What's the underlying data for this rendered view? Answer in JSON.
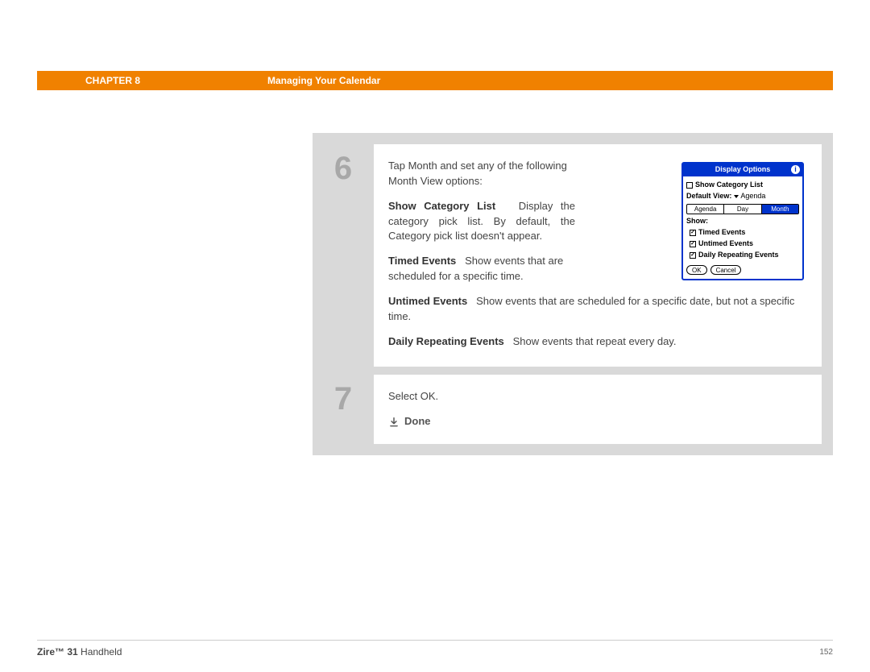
{
  "header": {
    "chapter": "CHAPTER 8",
    "title": "Managing Your Calendar"
  },
  "steps": [
    {
      "num": "6",
      "intro": "Tap Month and set any of the following Month View options:",
      "items": [
        {
          "label": "Show Category List",
          "desc": "Display the category pick list. By default, the Category pick list doesn't appear."
        },
        {
          "label": "Timed Events",
          "desc": "Show events that are scheduled for a specific time."
        },
        {
          "label": "Untimed Events",
          "desc": "Show events that are scheduled for a specific date, but not a specific time."
        },
        {
          "label": "Daily Repeating Events",
          "desc": "Show events that repeat every day."
        }
      ]
    },
    {
      "num": "7",
      "select_text": "Select OK.",
      "done": "Done"
    }
  ],
  "palm": {
    "title": "Display Options",
    "show_category": "Show Category List",
    "default_view_label": "Default View:",
    "default_view_value": "Agenda",
    "tabs": [
      "Agenda",
      "Day",
      "Month"
    ],
    "active_tab": "Month",
    "show_label": "Show:",
    "opts": [
      "Timed Events",
      "Untimed Events",
      "Daily Repeating Events"
    ],
    "ok": "OK",
    "cancel": "Cancel"
  },
  "footer": {
    "product_bold": "Zire™ 31",
    "product_rest": " Handheld",
    "page": "152"
  }
}
